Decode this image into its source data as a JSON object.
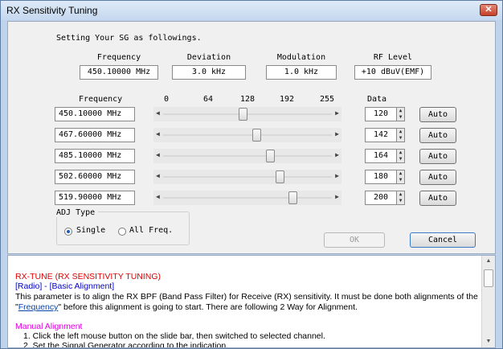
{
  "window": {
    "title": "RX Sensitivity Tuning",
    "close_glyph": "✕"
  },
  "setup": {
    "heading": "Setting Your SG as followings.",
    "headers": [
      "Frequency",
      "Deviation",
      "Modulation",
      "RF Level"
    ],
    "values": [
      "450.10000 MHz",
      "3.0 kHz",
      "1.0 kHz",
      "+10 dBuV(EMF)"
    ]
  },
  "table": {
    "frequency_label": "Frequency",
    "data_label": "Data",
    "scale": [
      "0",
      "64",
      "128",
      "192",
      "255"
    ],
    "auto_label": "Auto",
    "slider_max": 255,
    "rows": [
      {
        "freq": "450.10000 MHz",
        "data": "120",
        "value": 120
      },
      {
        "freq": "467.60000 MHz",
        "data": "142",
        "value": 142
      },
      {
        "freq": "485.10000 MHz",
        "data": "164",
        "value": 164
      },
      {
        "freq": "502.60000 MHz",
        "data": "180",
        "value": 180
      },
      {
        "freq": "519.90000 MHz",
        "data": "200",
        "value": 200
      }
    ]
  },
  "adj": {
    "title": "ADJ Type",
    "single": "Single",
    "all": "All Freq.",
    "selected": "single"
  },
  "buttons": {
    "ok": "OK",
    "cancel": "Cancel"
  },
  "help": {
    "title": "RX-TUNE (RX SENSITIVITY TUNING)",
    "path": "[Radio] - [Basic Alignment]",
    "para1": "This parameter is to align the RX BPF (Band Pass Filter) for Receive (RX) sensitivity. It must be done both alignments of the",
    "para2_pre": "\"",
    "para2_link": "Frequency",
    "para2_post": "\" before this alignment is going to start. There are following 2 Way for Alignment.",
    "manual_title": "Manual Alignment",
    "step1": "1. Click the left mouse button on the slide bar, then switched to selected channel.",
    "step2": "2. Set the Signal Generator according to the indication."
  }
}
